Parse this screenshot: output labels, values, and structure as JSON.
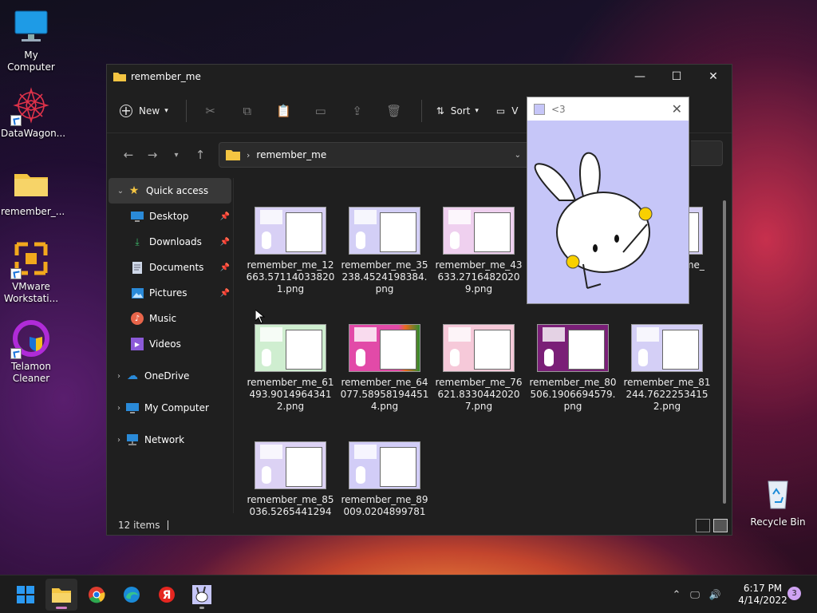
{
  "desktop": {
    "icons": [
      {
        "label": "My Computer"
      },
      {
        "label": "DataWagon..."
      },
      {
        "label": "remember_..."
      },
      {
        "label": "VMware Workstati..."
      },
      {
        "label": "Telamon Cleaner"
      },
      {
        "label": "Recycle Bin"
      }
    ]
  },
  "window": {
    "title": "remember_me",
    "toolbar": {
      "new_label": "New",
      "sort_label": "Sort",
      "view_label": "V"
    },
    "address": {
      "folder": "remember_me"
    },
    "nav": {
      "quick_access": "Quick access",
      "items": [
        {
          "label": "Desktop"
        },
        {
          "label": "Downloads"
        },
        {
          "label": "Documents"
        },
        {
          "label": "Pictures"
        },
        {
          "label": "Music"
        },
        {
          "label": "Videos"
        }
      ],
      "onedrive": "OneDrive",
      "my_computer": "My Computer",
      "network": "Network"
    },
    "files": [
      {
        "name": "remember_me_12663.571140338201.png",
        "bg": "#d8d0f5"
      },
      {
        "name": "remember_me_35238.4524198384.png",
        "bg": "#d3cff6"
      },
      {
        "name": "remember_me_43633.27164820209.png",
        "bg": "#efd0ef"
      },
      {
        "name": "remember_me_5...94",
        "bg": "#d6d0f6"
      },
      {
        "name": "remember_me_61493.90149643412.png",
        "bg": "#cfeed0"
      },
      {
        "name": "remember_me_64077.589581944514.png",
        "bg": "#e24aa8"
      },
      {
        "name": "remember_me_76621.83304420207.png",
        "bg": "#f6c9d9"
      },
      {
        "name": "remember_me_80506.1906694579.png",
        "bg": "#7a1f77"
      },
      {
        "name": "remember_me_81244.76222534152.png",
        "bg": "#d4cff6"
      },
      {
        "name": "remember_me_85036.5265441294",
        "bg": "#dcd2f4"
      },
      {
        "name": "remember_me_89009.0204899781",
        "bg": "#d2cdf7"
      }
    ],
    "status": {
      "count": "12 items"
    }
  },
  "popup": {
    "title": "<3"
  },
  "taskbar": {
    "time": "6:17 PM",
    "date": "4/14/2022",
    "notifications": "3"
  },
  "colors": {
    "accent": "#d17ec4",
    "popup_bg": "#c6c6f8",
    "folder": "#f4c542"
  }
}
